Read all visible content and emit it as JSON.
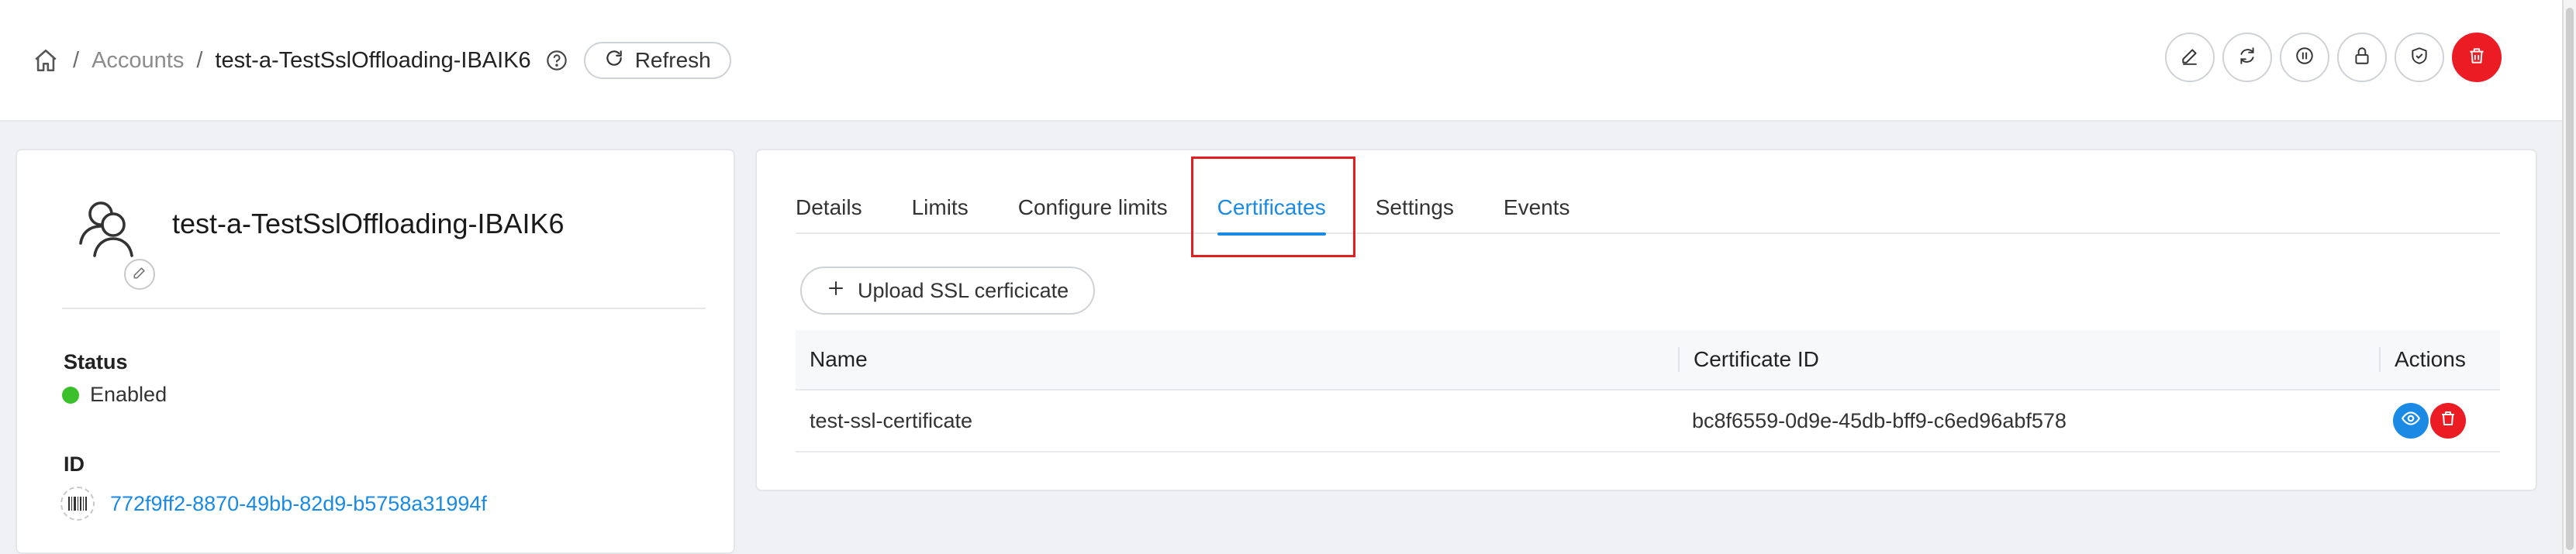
{
  "breadcrumb": {
    "home_icon": "home-icon",
    "separator": "/",
    "accounts_label": "Accounts",
    "current_label": "test-a-TestSslOffloading-IBAIK6",
    "help_icon": "question-circle-icon",
    "refresh_label": "Refresh"
  },
  "header_actions": [
    {
      "name": "edit-button",
      "icon": "pencil-icon"
    },
    {
      "name": "sync-button",
      "icon": "sync-icon"
    },
    {
      "name": "pause-button",
      "icon": "pause-icon"
    },
    {
      "name": "lock-button",
      "icon": "lock-icon"
    },
    {
      "name": "shield-button",
      "icon": "shield-check-icon"
    },
    {
      "name": "delete-button",
      "icon": "trash-icon"
    }
  ],
  "account": {
    "name": "test-a-TestSslOffloading-IBAIK6",
    "status_label": "Status",
    "status_value": "Enabled",
    "id_label": "ID",
    "id_value": "772f9ff2-8870-49bb-82d9-b5758a31994f"
  },
  "tabs": [
    {
      "label": "Details",
      "active": false
    },
    {
      "label": "Limits",
      "active": false
    },
    {
      "label": "Configure limits",
      "active": false
    },
    {
      "label": "Certificates",
      "active": true
    },
    {
      "label": "Settings",
      "active": false
    },
    {
      "label": "Events",
      "active": false
    }
  ],
  "certificates": {
    "upload_label": "Upload SSL cerficicate",
    "columns": [
      "Name",
      "Certificate ID",
      "Actions"
    ],
    "rows": [
      {
        "name": "test-ssl-certificate",
        "certificate_id": "bc8f6559-0d9e-45db-bff9-c6ed96abf578"
      }
    ]
  },
  "colors": {
    "accent": "#1a8ae5",
    "danger": "#ec1c24",
    "status_enabled": "#3bbf2a",
    "highlight": "#e02020"
  }
}
